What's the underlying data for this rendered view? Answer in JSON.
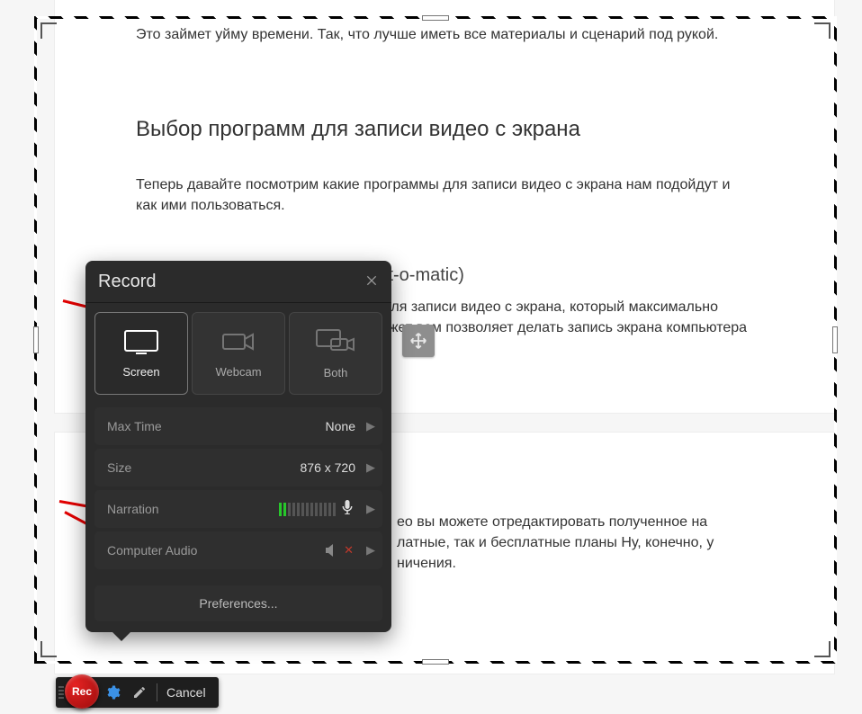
{
  "article": {
    "top_text": "Это займет уйму времени. Так, что лучше иметь все материалы и сценарий под рукой.",
    "heading": "Выбор программ для записи видео с экрана",
    "intro": "Теперь давайте посмотрим какие программы для записи видео с экрана нам подойдут и как ими пользоваться.",
    "subheading": "Скринкаст-о-метик (Screencast-o-matic)",
    "desc": "Screencast-O-Matic - это инструмент для записи видео с экрана, который максимально простой и понятный инструмент поможет вам позволяет делать запись экрана компьютера с"
  },
  "article2": {
    "tail": "ео вы можете отредактировать полученное на",
    "tail2": "латные, так и бесплатные планы Ну, конечно, у",
    "tail3": "ничения."
  },
  "panel": {
    "title": "Record",
    "modes": {
      "screen": "Screen",
      "webcam": "Webcam",
      "both": "Both"
    },
    "rows": {
      "maxtime_label": "Max Time",
      "maxtime_value": "None",
      "size_label": "Size",
      "size_value": "876 x 720",
      "narration_label": "Narration",
      "audio_label": "Computer Audio"
    },
    "prefs": "Preferences..."
  },
  "toolbar": {
    "rec": "Rec",
    "cancel": "Cancel"
  }
}
